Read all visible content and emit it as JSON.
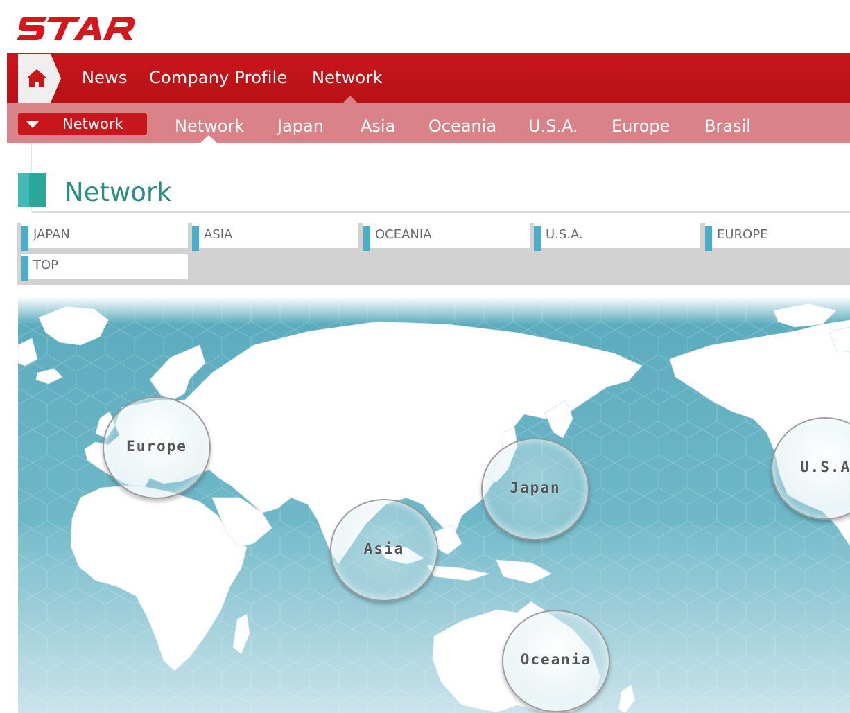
{
  "logo": {
    "text": "STAR"
  },
  "main_nav": {
    "home_icon": "home-icon",
    "items": [
      "News",
      "Company Profile",
      "Network"
    ]
  },
  "sub_nav": {
    "dropdown_label": "Network",
    "dropdown_icon": "caret-down-icon",
    "items": [
      "Network",
      "Japan",
      "Asia",
      "Oceania",
      "U.S.A.",
      "Europe",
      "Brasil"
    ]
  },
  "page": {
    "title": "Network"
  },
  "regions": [
    "JAPAN",
    "ASIA",
    "OCEANIA",
    "U.S.A.",
    "EUROPE",
    "TOP"
  ],
  "map": {
    "markers": [
      "Europe",
      "Japan",
      "Asia",
      "U.S.A.",
      "Oceania"
    ]
  },
  "colors": {
    "brand_red": "#c8161b",
    "subnav_pink": "#d98288",
    "teal": "#2a8d84",
    "ocean": "#5fb0c2"
  }
}
